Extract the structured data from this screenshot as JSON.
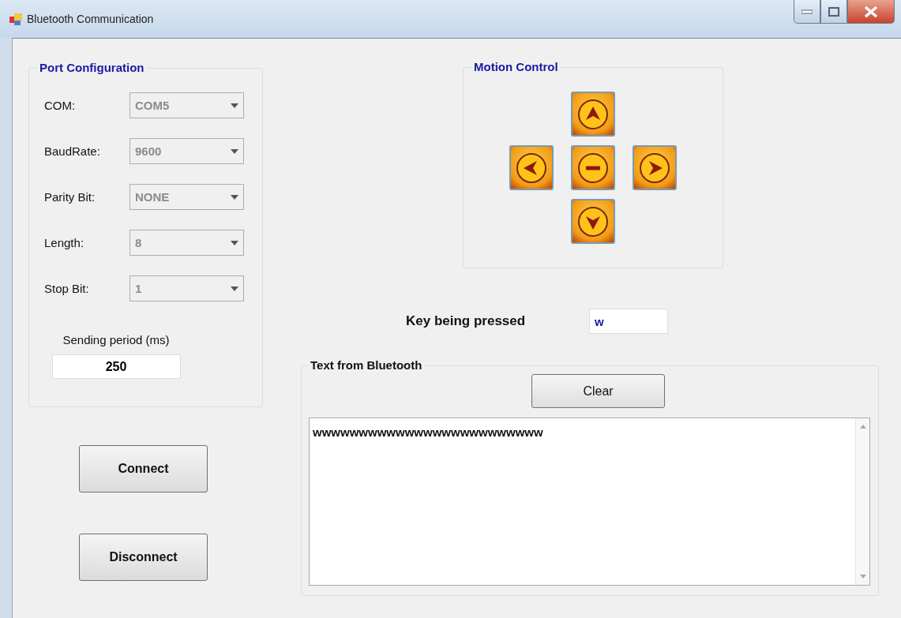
{
  "window": {
    "title": "Bluetooth Communication"
  },
  "port_configuration": {
    "title": "Port Configuration",
    "fields": [
      {
        "label": "COM:",
        "value": "COM5",
        "disabled": true
      },
      {
        "label": "BaudRate:",
        "value": "9600",
        "disabled": true
      },
      {
        "label": "Parity Bit:",
        "value": "NONE",
        "disabled": true
      },
      {
        "label": "Length:",
        "value": "8",
        "disabled": true
      },
      {
        "label": "Stop Bit:",
        "value": "1",
        "disabled": true
      }
    ],
    "sending_period": {
      "label": "Sending period (ms)",
      "value": "250"
    }
  },
  "buttons": [
    {
      "label": "Connect"
    },
    {
      "label": "Disconnect"
    }
  ],
  "motion_control": {
    "title": "Motion Control",
    "buttons": [
      {
        "kind": "up"
      },
      {
        "kind": "left"
      },
      {
        "kind": "stop"
      },
      {
        "kind": "right"
      },
      {
        "kind": "down"
      }
    ]
  },
  "key_pressed": {
    "label": "Key being pressed",
    "value": "w"
  },
  "text_from_bluetooth": {
    "title": "Text from Bluetooth",
    "clear_button": "Clear",
    "text": "wwwwwwwwwwwwwwwwwwwwwwwww"
  }
}
